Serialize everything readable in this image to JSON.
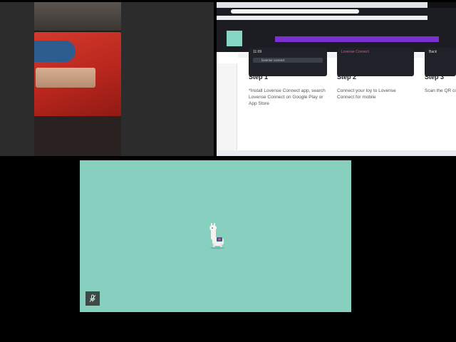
{
  "screen_share": {
    "steps": [
      {
        "title": "Step 1",
        "text": "*Install Lovense Connect app, search Lovense Connect on Google Play or App Store"
      },
      {
        "title": "Step 2",
        "text": "Connect your toy to Lovense Connect for mobile"
      },
      {
        "title": "Step 3",
        "text": "Scan the QR co"
      }
    ],
    "card1": {
      "time": "11:09",
      "search": "lovense connect"
    },
    "card2": {
      "label": "Lovense Connect"
    },
    "card3": {
      "back": "Back"
    }
  },
  "toy_tile": {
    "mascot_icon": "llama-mascot-icon",
    "mute_icon": "microphone-off-icon",
    "background": "#87d0c0"
  }
}
